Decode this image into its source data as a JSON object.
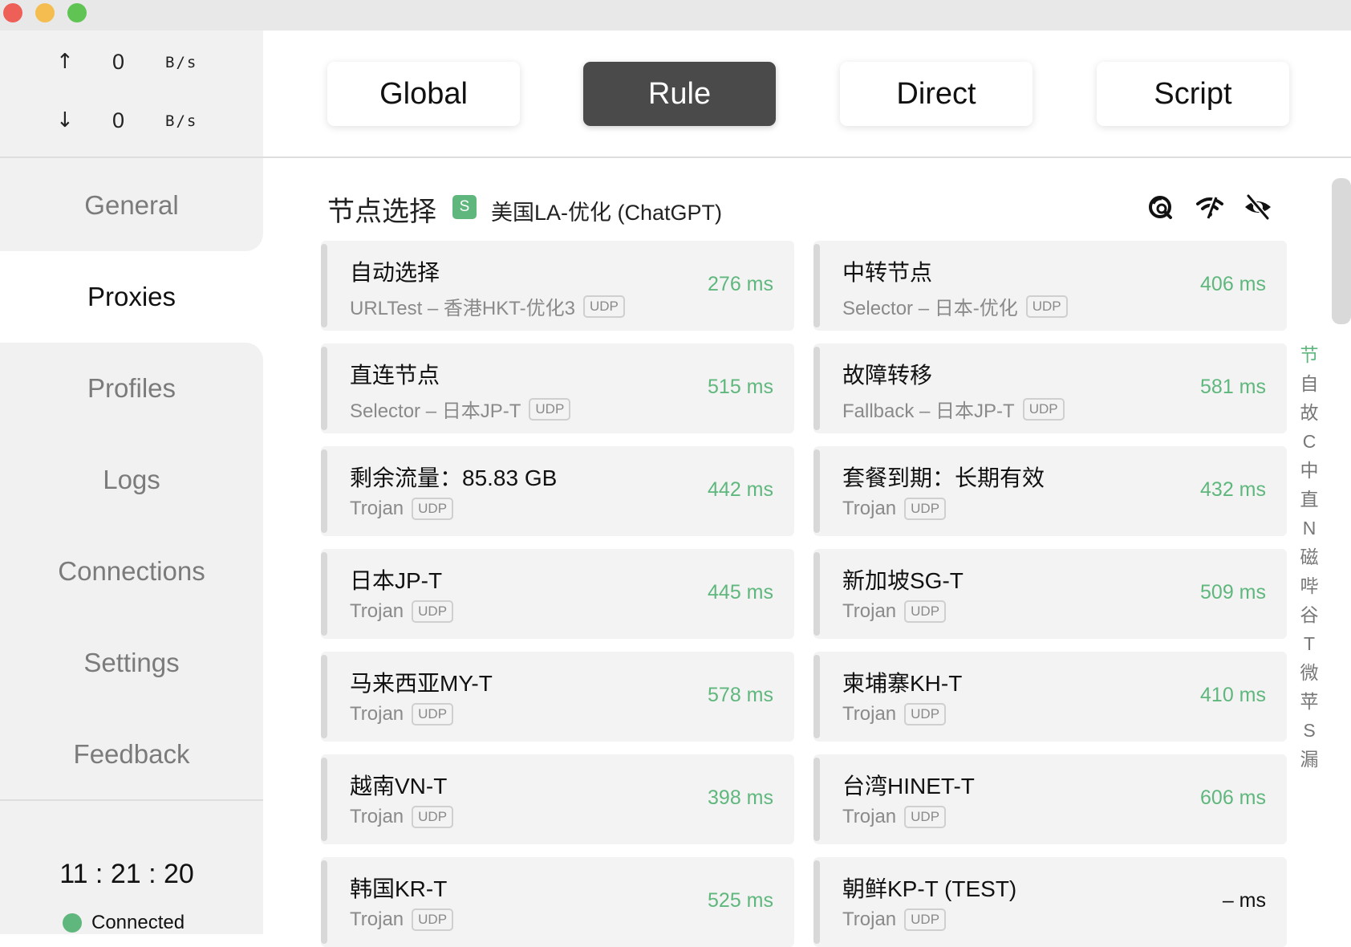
{
  "traffic": {
    "up_arrow": "↑",
    "up_value": "0",
    "up_unit": "B/s",
    "down_arrow": "↓",
    "down_value": "0",
    "down_unit": "B/s"
  },
  "nav": {
    "general": "General",
    "proxies": "Proxies",
    "profiles": "Profiles",
    "logs": "Logs",
    "connections": "Connections",
    "settings": "Settings",
    "feedback": "Feedback"
  },
  "clock": "11 : 21 : 20",
  "status": "Connected",
  "modes": {
    "global": "Global",
    "rule": "Rule",
    "direct": "Direct",
    "script": "Script",
    "selected": "Rule"
  },
  "group": {
    "title": "节点选择",
    "type_badge": "S",
    "current": "美国LA-优化 (ChatGPT)"
  },
  "cards": [
    {
      "name": "自动选择",
      "type": "URLTest – 香港HKT-优化3",
      "udp": "UDP",
      "delay": "276 ms"
    },
    {
      "name": "中转节点",
      "type": "Selector – 日本-优化",
      "udp": "UDP",
      "delay": "406 ms"
    },
    {
      "name": "直连节点",
      "type": "Selector – 日本JP-T",
      "udp": "UDP",
      "delay": "515 ms"
    },
    {
      "name": "故障转移",
      "type": "Fallback – 日本JP-T",
      "udp": "UDP",
      "delay": "581 ms"
    },
    {
      "name": "剩余流量：85.83 GB",
      "type": "Trojan",
      "udp": "UDP",
      "delay": "442 ms"
    },
    {
      "name": "套餐到期：长期有效",
      "type": "Trojan",
      "udp": "UDP",
      "delay": "432 ms"
    },
    {
      "name": "日本JP-T",
      "type": "Trojan",
      "udp": "UDP",
      "delay": "445 ms"
    },
    {
      "name": "新加坡SG-T",
      "type": "Trojan",
      "udp": "UDP",
      "delay": "509 ms"
    },
    {
      "name": "马来西亚MY-T",
      "type": "Trojan",
      "udp": "UDP",
      "delay": "578 ms"
    },
    {
      "name": "柬埔寨KH-T",
      "type": "Trojan",
      "udp": "UDP",
      "delay": "410 ms"
    },
    {
      "name": "越南VN-T",
      "type": "Trojan",
      "udp": "UDP",
      "delay": "398 ms"
    },
    {
      "name": "台湾HINET-T",
      "type": "Trojan",
      "udp": "UDP",
      "delay": "606 ms"
    },
    {
      "name": "韩国KR-T",
      "type": "Trojan",
      "udp": "UDP",
      "delay": "525 ms"
    },
    {
      "name": "朝鲜KP-T (TEST)",
      "type": "Trojan",
      "udp": "UDP",
      "delay": "– ms"
    }
  ],
  "index_letters": [
    "节",
    "自",
    "故",
    "C",
    "中",
    "直",
    "N",
    "磁",
    "哔",
    "谷",
    "T",
    "微",
    "苹",
    "S",
    "漏"
  ],
  "icons": {
    "header": [
      "search-delay-icon",
      "wifi-off-icon",
      "eye-off-icon"
    ]
  },
  "colors": {
    "accent_green": "#5fb77d",
    "active_mode_bg": "#4a4a4a",
    "sidebar_bg": "#f1f1f1"
  }
}
